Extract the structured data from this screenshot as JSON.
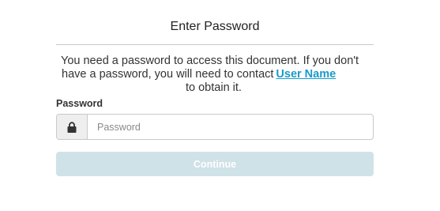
{
  "dialog": {
    "title": "Enter Password",
    "message_line1": "You need a password to access this document. If you don't",
    "message_line2": "have a password, you will need to contact",
    "contact_link": "User Name",
    "message_line3": "to obtain it."
  },
  "password_field": {
    "label": "Password",
    "placeholder": "Password",
    "value": "",
    "icon": "lock-icon"
  },
  "continue_button": {
    "label": "Continue",
    "state": "disabled"
  },
  "colors": {
    "link": "#1a9bc9",
    "button_disabled_bg": "#cfe2e8",
    "divider": "#c8c8c8"
  }
}
